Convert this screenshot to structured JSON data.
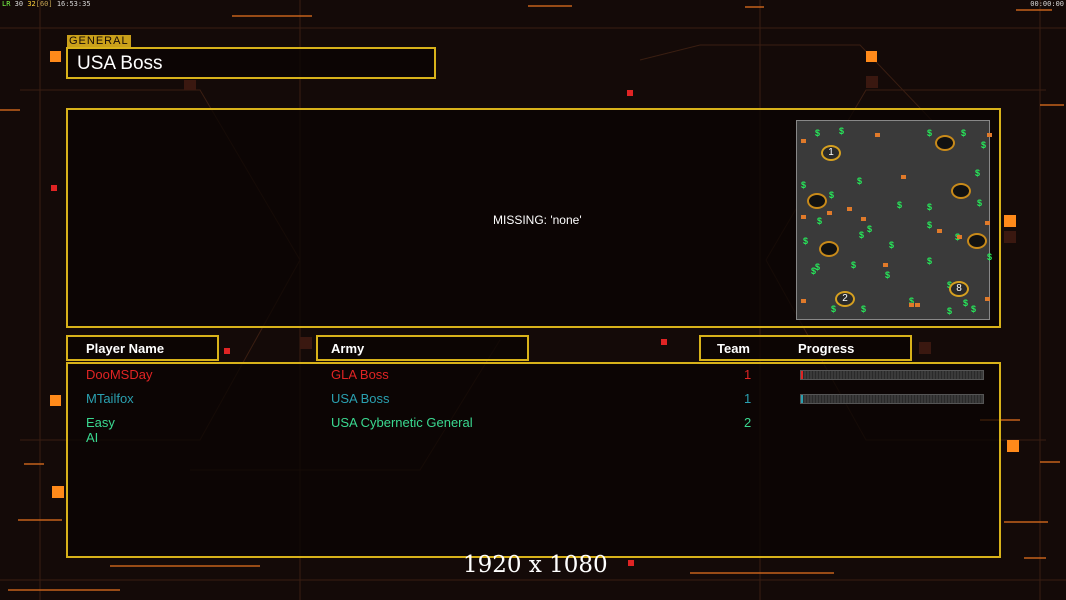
{
  "hud": {
    "left_flag": "LR",
    "left_a": "30",
    "left_b": "32",
    "left_c": "[60]",
    "clock": "16:53:35",
    "timer": "00:00:00"
  },
  "general_tag": "GENERAL",
  "general_name": "USA Boss",
  "preview_status": "MISSING: 'none'",
  "map": {
    "start_labels": [
      "1",
      "2",
      "8"
    ]
  },
  "table": {
    "headers": {
      "player": "Player Name",
      "army": "Army",
      "team": "Team",
      "progress": "Progress"
    },
    "rows": [
      {
        "name": "DooMSDay",
        "army": "GLA Boss",
        "team": "1",
        "color": "#e02424",
        "progress": 0.01,
        "show_bar": true
      },
      {
        "name": "MTailfox",
        "army": "USA Boss",
        "team": "1",
        "color": "#2aa0b0",
        "progress": 0.01,
        "show_bar": true
      },
      {
        "name": "Easy AI",
        "army": "USA Cybernetic General",
        "team": "2",
        "color": "#3ad890",
        "progress": 0,
        "show_bar": false
      }
    ]
  },
  "resolution": "1920 x 1080",
  "colors": {
    "accent": "#d8b21a",
    "background": "#140a08",
    "glow": "#ff8a1a"
  }
}
